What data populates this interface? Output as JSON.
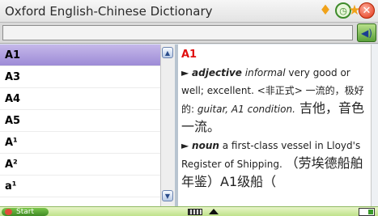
{
  "window": {
    "title": "Oxford English-Chinese Dictionary"
  },
  "search": {
    "value": ""
  },
  "word_list": [
    "A1",
    "A3",
    "A4",
    "A5",
    "A¹",
    "A²",
    "a¹"
  ],
  "selected_word": "A1",
  "definition": {
    "headword": "A1",
    "sense1": {
      "pos": "adjective",
      "register": "informal",
      "gloss": " very good or well; excellent. <非正式> 一流的，极好的: ",
      "example": "guitar, A1 condition.",
      "example_cn": " 吉他，音色一流。"
    },
    "sense2": {
      "pos": "noun",
      "gloss": " a first-class vessel in Lloyd's Register of Shipping. ",
      "cn": "（劳埃德船舶年鉴）A1级船（"
    }
  },
  "taskbar": {
    "start_label": "Start"
  },
  "icons": {
    "favorite": "diamond-icon",
    "history": "clock-icon",
    "bookmark": "star-icon",
    "close": "close-icon",
    "pronounce": "speaker-icon",
    "keyboard": "keyboard-icon",
    "menu": "up-arrow-icon",
    "battery": "battery-icon"
  },
  "colors": {
    "accent_headword": "#e01010",
    "selection": "#9d8bd6",
    "taskbar": "#bfe28a"
  }
}
